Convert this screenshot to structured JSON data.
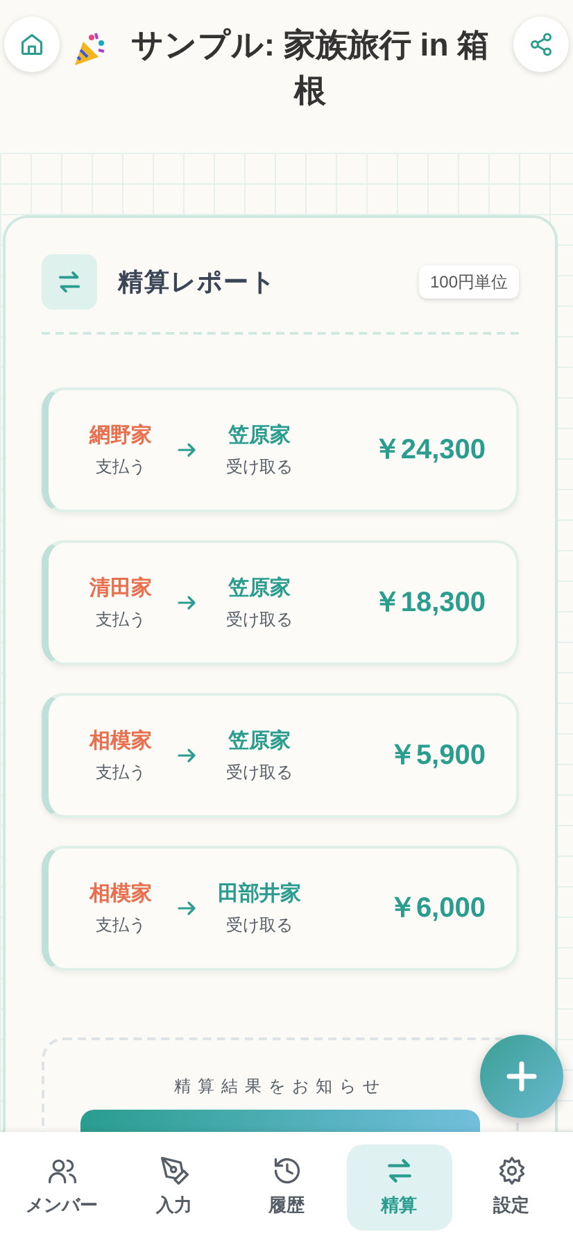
{
  "header": {
    "title": "サンプル: 家族旅行 in 箱根"
  },
  "report": {
    "title": "精算レポート",
    "badge": "100円単位",
    "transfers": [
      {
        "payer": "網野家",
        "payer_label": "支払う",
        "payee": "笠原家",
        "payee_label": "受け取る",
        "amount": "￥24,300"
      },
      {
        "payer": "清田家",
        "payer_label": "支払う",
        "payee": "笠原家",
        "payee_label": "受け取る",
        "amount": "￥18,300"
      },
      {
        "payer": "相模家",
        "payer_label": "支払う",
        "payee": "笠原家",
        "payee_label": "受け取る",
        "amount": "￥5,900"
      },
      {
        "payer": "相模家",
        "payer_label": "支払う",
        "payee": "田部井家",
        "payee_label": "受け取る",
        "amount": "￥6,000"
      }
    ],
    "notify": {
      "label": "精算結果をお知らせ"
    }
  },
  "nav": [
    {
      "kind": "members",
      "label": "メンバー",
      "selected": false
    },
    {
      "kind": "input",
      "label": "入力",
      "selected": false
    },
    {
      "kind": "history",
      "label": "履歴",
      "selected": false
    },
    {
      "kind": "settle",
      "label": "精算",
      "selected": true
    },
    {
      "kind": "settings",
      "label": "設定",
      "selected": false
    }
  ]
}
